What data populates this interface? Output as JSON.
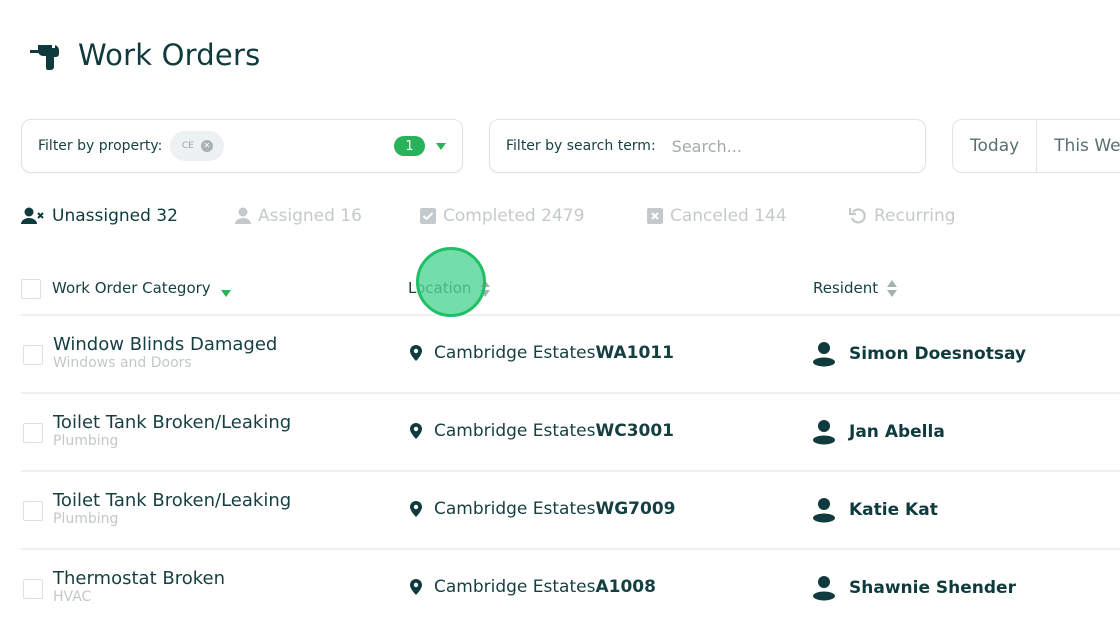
{
  "header": {
    "title": "Work Orders",
    "icon": "drill-icon"
  },
  "filters": {
    "property": {
      "label": "Filter by property:",
      "chip_text": "CE",
      "chip_remove_icon": "close-circle-icon",
      "selected_count": "1",
      "caret_icon": "caret-down-icon"
    },
    "search": {
      "label": "Filter by search term:",
      "value": "",
      "placeholder": "Search..."
    },
    "date_range": {
      "options": [
        "Today",
        "This Week"
      ]
    }
  },
  "tabs": [
    {
      "label": "Unassigned 32",
      "icon": "user-x-icon",
      "active": true
    },
    {
      "label": "Assigned 16",
      "icon": "user-icon",
      "active": false
    },
    {
      "label": "Completed 2479",
      "icon": "check-square-icon",
      "active": false
    },
    {
      "label": "Canceled 144",
      "icon": "x-square-icon",
      "active": false
    },
    {
      "label": "Recurring",
      "icon": "refresh-icon",
      "active": false
    }
  ],
  "table": {
    "columns": [
      {
        "label": "Work Order Category",
        "sort": "descending"
      },
      {
        "label": "Location",
        "sort": "none"
      },
      {
        "label": "Resident",
        "sort": "none"
      }
    ],
    "rows": [
      {
        "title": "Window Blinds Damaged",
        "category": "Windows and Doors",
        "property": "Cambridge Estates",
        "unit": "WA1011",
        "resident": "Simon Doesnotsay"
      },
      {
        "title": "Toilet Tank Broken/Leaking",
        "category": "Plumbing",
        "property": "Cambridge Estates",
        "unit": "WC3001",
        "resident": "Jan Abella"
      },
      {
        "title": "Toilet Tank Broken/Leaking",
        "category": "Plumbing",
        "property": "Cambridge Estates",
        "unit": "WG7009",
        "resident": "Katie Kat"
      },
      {
        "title": "Thermostat Broken",
        "category": "HVAC",
        "property": "Cambridge Estates",
        "unit": "A1008",
        "resident": "Shawnie Shender"
      }
    ]
  },
  "colors": {
    "primary_text": "#0f3b3e",
    "accent_green": "#27b35a",
    "inactive_text": "#c4cacb",
    "subtext": "#c2c8c9"
  }
}
